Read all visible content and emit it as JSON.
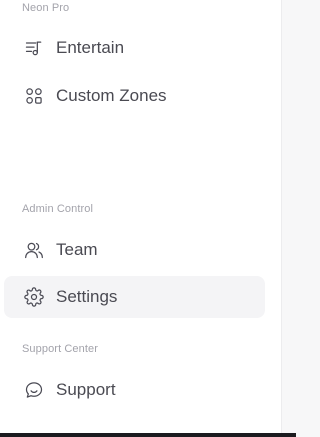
{
  "sidebar": {
    "sections": [
      {
        "label": "Neon Pro",
        "items": [
          {
            "label": "Entertain",
            "icon": "music-playlist-icon"
          },
          {
            "label": "Custom Zones",
            "icon": "grid-icon"
          }
        ]
      },
      {
        "label": "Admin Control",
        "items": [
          {
            "label": "Team",
            "icon": "users-icon"
          },
          {
            "label": "Settings",
            "icon": "gear-icon",
            "active": true
          }
        ]
      },
      {
        "label": "Support Center",
        "items": [
          {
            "label": "Support",
            "icon": "chat-bubble-icon"
          }
        ]
      }
    ]
  },
  "colors": {
    "active_item_bg": "#f4f4f6",
    "text": "#4a4a52",
    "section_label": "#a3a3ab",
    "icon_stroke": "#4b4b55"
  }
}
